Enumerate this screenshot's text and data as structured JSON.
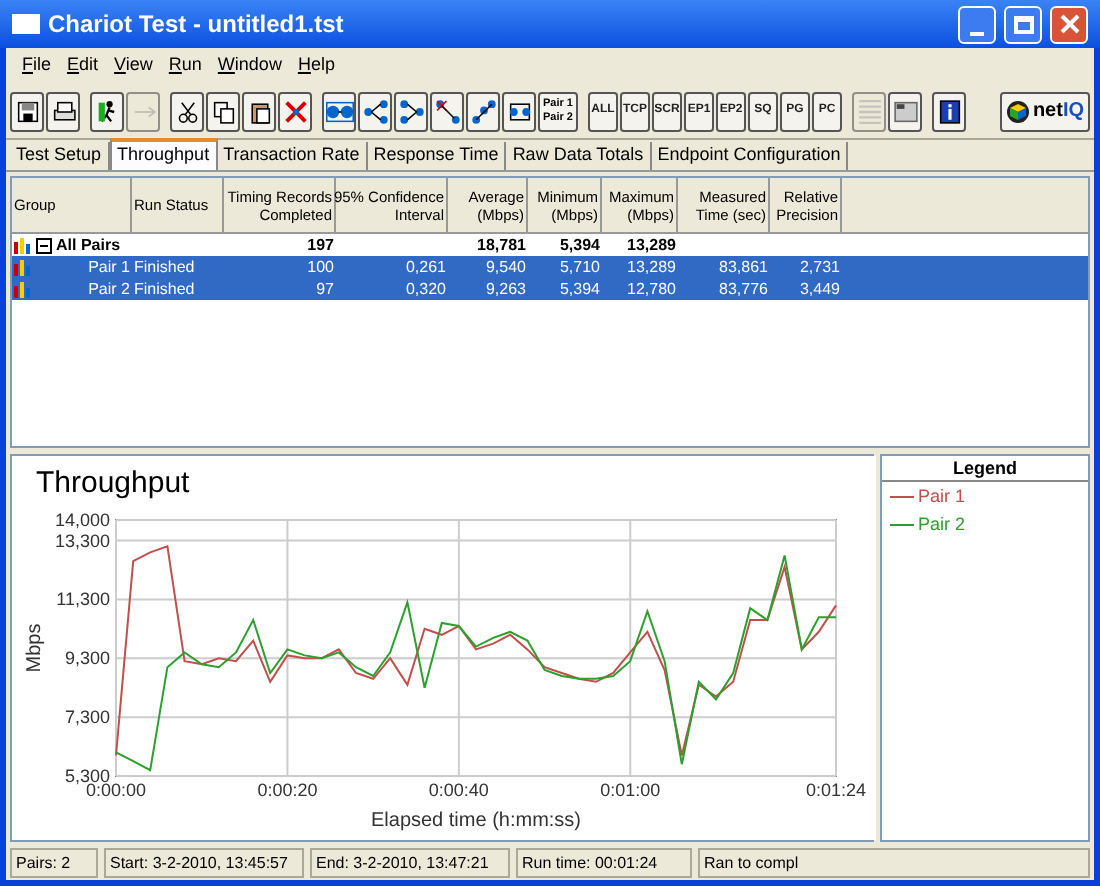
{
  "window": {
    "title": "Chariot Test - untitled1.tst"
  },
  "menu": [
    {
      "label": "File"
    },
    {
      "label": "Edit"
    },
    {
      "label": "View"
    },
    {
      "label": "Run"
    },
    {
      "label": "Window"
    },
    {
      "label": "Help"
    }
  ],
  "toolbar": [
    {
      "kind": "icon",
      "disabled": false
    },
    {
      "kind": "icon",
      "disabled": false
    },
    {
      "kind": "sep"
    },
    {
      "kind": "icon",
      "disabled": false
    },
    {
      "kind": "icon",
      "disabled": true
    },
    {
      "kind": "sep"
    },
    {
      "kind": "icon",
      "disabled": false
    },
    {
      "kind": "icon",
      "disabled": false
    },
    {
      "kind": "icon",
      "disabled": false
    },
    {
      "kind": "icon",
      "disabled": false
    },
    {
      "kind": "sep"
    },
    {
      "kind": "icon",
      "disabled": false
    },
    {
      "kind": "icon",
      "disabled": false
    },
    {
      "kind": "icon",
      "disabled": false
    },
    {
      "kind": "icon",
      "disabled": false
    },
    {
      "kind": "icon",
      "disabled": false
    },
    {
      "kind": "icon",
      "disabled": false
    },
    {
      "kind": "pair",
      "lines": [
        "Pair 1",
        "Pair 2"
      ],
      "disabled": false
    },
    {
      "kind": "sep"
    },
    {
      "kind": "text",
      "label": "ALL",
      "disabled": false
    },
    {
      "kind": "text",
      "label": "TCP",
      "disabled": false
    },
    {
      "kind": "text",
      "label": "SCR",
      "disabled": false
    },
    {
      "kind": "text",
      "label": "EP1",
      "disabled": false
    },
    {
      "kind": "text",
      "label": "EP2",
      "disabled": false
    },
    {
      "kind": "text",
      "label": "SQ",
      "disabled": false
    },
    {
      "kind": "text",
      "label": "PG",
      "disabled": false
    },
    {
      "kind": "text",
      "label": "PC",
      "disabled": false
    },
    {
      "kind": "sep"
    },
    {
      "kind": "icon",
      "disabled": true
    },
    {
      "kind": "icon",
      "disabled": false
    },
    {
      "kind": "sep"
    },
    {
      "kind": "icon",
      "disabled": false
    },
    {
      "kind": "logo",
      "label": "net",
      "accent": "IQ",
      "disabled": false
    }
  ],
  "tabs": [
    {
      "label": "Test Setup",
      "selected": false
    },
    {
      "label": "Throughput",
      "selected": true
    },
    {
      "label": "Transaction Rate",
      "selected": false
    },
    {
      "label": "Response Time",
      "selected": false
    },
    {
      "label": "Raw Data Totals",
      "selected": false
    },
    {
      "label": "Endpoint Configuration",
      "selected": false
    }
  ],
  "table": {
    "columns": [
      {
        "label": "Group"
      },
      {
        "label": "Run Status"
      },
      {
        "label": "Timing Records\nCompleted"
      },
      {
        "label": "95% Confidence\nInterval"
      },
      {
        "label": "Average\n(Mbps)"
      },
      {
        "label": "Minimum\n(Mbps)"
      },
      {
        "label": "Maximum\n(Mbps)"
      },
      {
        "label": "Measured\nTime (sec)"
      },
      {
        "label": "Relative\nPrecision"
      }
    ],
    "rows": [
      {
        "kind": "group",
        "expanded": true,
        "selected": false,
        "cells": [
          "All Pairs",
          "",
          "197",
          "",
          "18,781",
          "5,394",
          "13,289",
          "",
          ""
        ]
      },
      {
        "kind": "pair",
        "selected": true,
        "cells": [
          "Pair 1",
          "Finished",
          "100",
          "0,261",
          "9,540",
          "5,710",
          "13,289",
          "83,861",
          "2,731"
        ]
      },
      {
        "kind": "pair",
        "selected": true,
        "cells": [
          "Pair 2",
          "Finished",
          "97",
          "0,320",
          "9,263",
          "5,394",
          "12,780",
          "83,776",
          "3,449"
        ]
      }
    ]
  },
  "chart": {
    "chart_data": {
      "type": "line",
      "title": "Throughput",
      "xlabel": "Elapsed time (h:mm:ss)",
      "ylabel": "Mbps",
      "x": [
        0,
        2,
        4,
        6,
        8,
        10,
        12,
        14,
        16,
        18,
        20,
        22,
        24,
        26,
        28,
        30,
        32,
        34,
        36,
        38,
        40,
        42,
        44,
        46,
        48,
        50,
        52,
        54,
        56,
        58,
        60,
        62,
        64,
        66,
        68,
        70,
        72,
        74,
        76,
        78,
        80,
        82,
        84
      ],
      "series": [
        {
          "name": "Pair 1",
          "color": "#c0504d",
          "values": [
            6.0,
            12.6,
            12.9,
            13.1,
            9.2,
            9.1,
            9.3,
            9.2,
            9.9,
            8.5,
            9.4,
            9.3,
            9.3,
            9.6,
            8.8,
            8.6,
            9.3,
            8.4,
            10.3,
            10.1,
            10.4,
            9.6,
            9.8,
            10.1,
            9.6,
            9.0,
            8.8,
            8.6,
            8.5,
            8.8,
            9.5,
            10.2,
            8.9,
            6.0,
            8.4,
            8.0,
            8.5,
            10.6,
            10.6,
            12.4,
            9.6,
            10.2,
            11.1
          ]
        },
        {
          "name": "Pair 2",
          "color": "#2ca02c",
          "values": [
            6.1,
            5.8,
            5.5,
            9.0,
            9.5,
            9.1,
            9.0,
            9.5,
            10.6,
            8.8,
            9.6,
            9.4,
            9.3,
            9.5,
            9.0,
            8.7,
            9.5,
            11.2,
            8.3,
            10.5,
            10.4,
            9.7,
            10.0,
            10.2,
            9.9,
            8.9,
            8.7,
            8.6,
            8.6,
            8.7,
            9.2,
            10.9,
            9.2,
            5.7,
            8.5,
            7.9,
            8.8,
            11.0,
            10.6,
            12.8,
            9.6,
            10.7,
            10.7
          ]
        }
      ],
      "grid": true,
      "xlim": [
        0,
        84
      ],
      "ylim": [
        5.3,
        14.0
      ],
      "xticks": [
        {
          "value": 0,
          "label": "0:00:00"
        },
        {
          "value": 20,
          "label": "0:00:20"
        },
        {
          "value": 40,
          "label": "0:00:40"
        },
        {
          "value": 60,
          "label": "0:01:00"
        },
        {
          "value": 84,
          "label": "0:01:24"
        }
      ],
      "yticks": [
        {
          "value": 5.3,
          "label": "5,300"
        },
        {
          "value": 7.3,
          "label": "7,300"
        },
        {
          "value": 9.3,
          "label": "9,300"
        },
        {
          "value": 11.3,
          "label": "11,300"
        },
        {
          "value": 13.3,
          "label": "13,300"
        },
        {
          "value": 14.0,
          "label": "14,000"
        }
      ]
    }
  },
  "legend": {
    "title": "Legend"
  },
  "status_bar": [
    "Pairs: 2",
    "Start: 3-2-2010, 13:45:57",
    "End: 3-2-2010, 13:47:21",
    "Run time: 00:01:24",
    "Ran to compl"
  ]
}
